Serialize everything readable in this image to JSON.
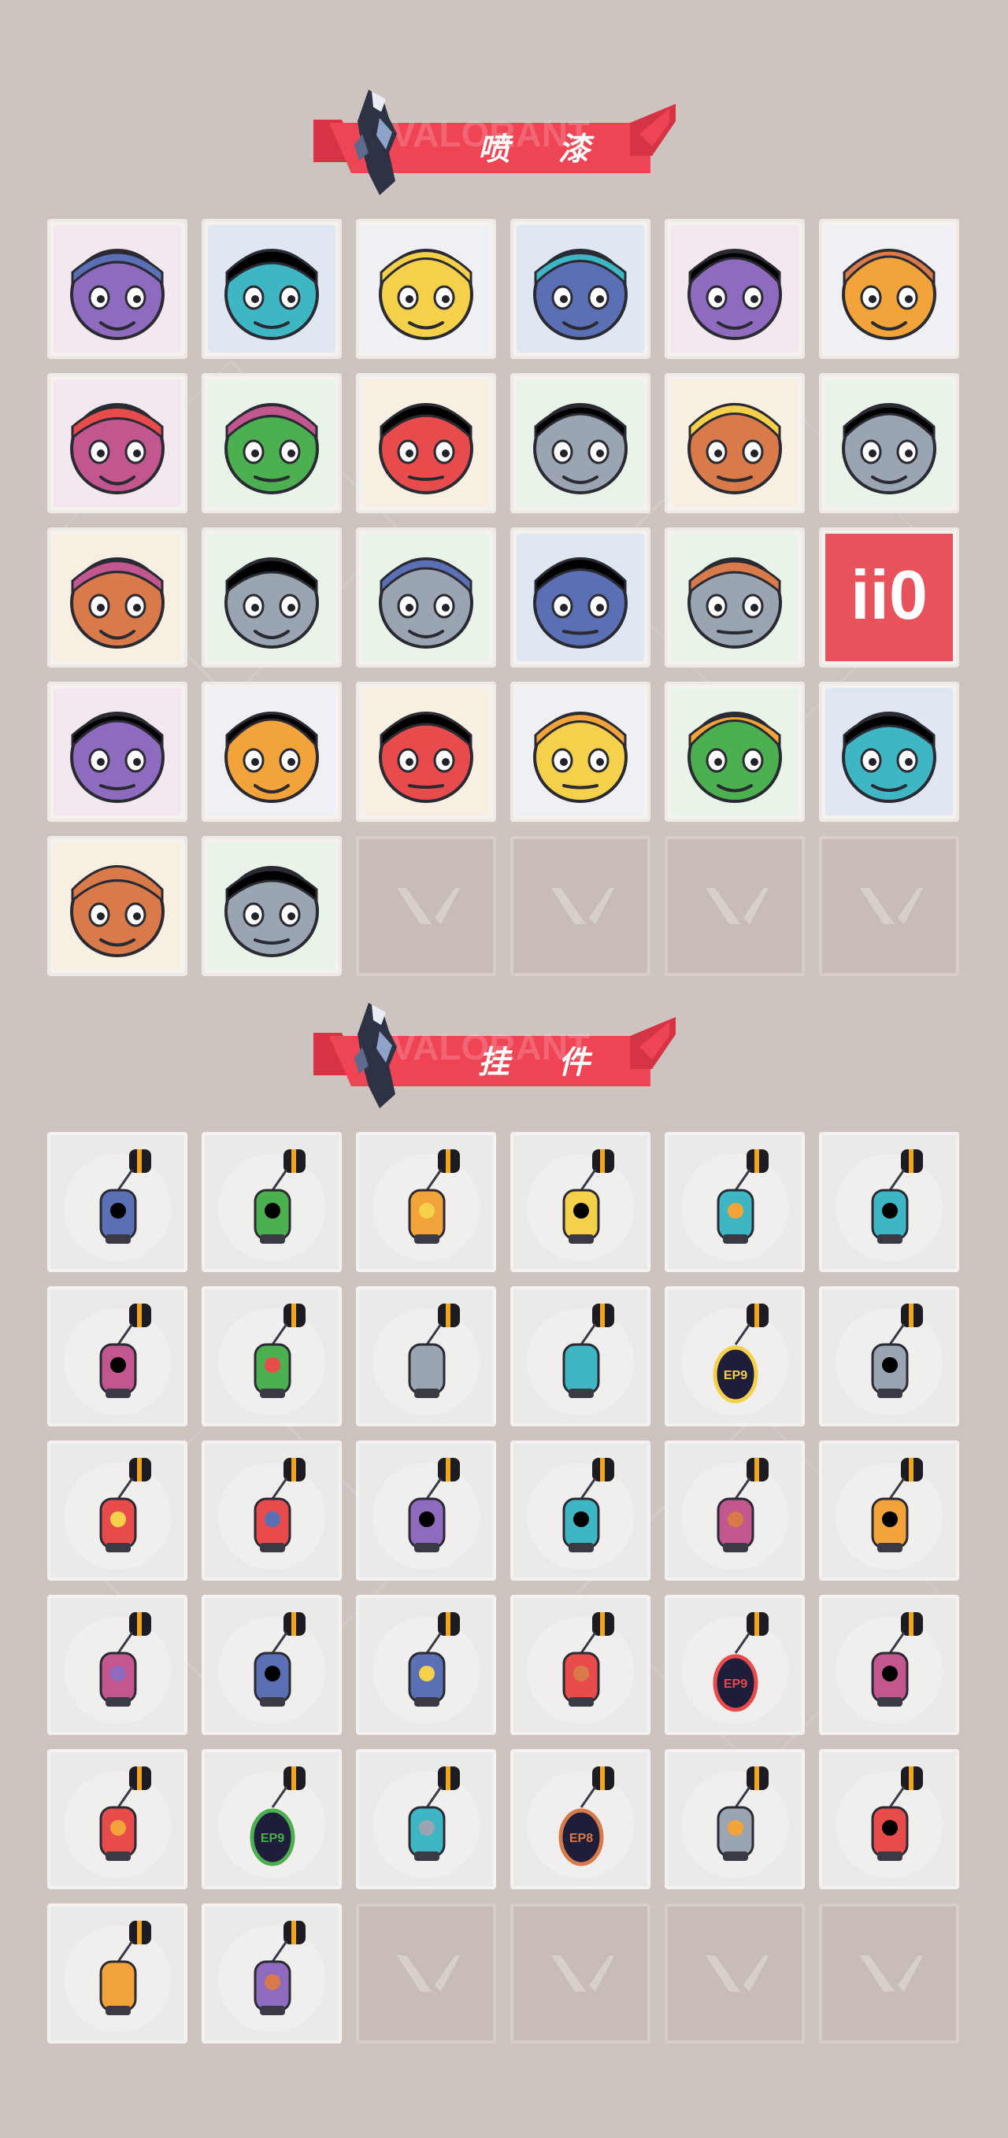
{
  "sections": [
    {
      "id": "sprays",
      "title": "喷 漆",
      "items": [
        {
          "name": "pixel-agent-spray",
          "icon": "pixel-agent-icon"
        },
        {
          "name": "armored-knight-spray",
          "icon": "armored-knight-icon"
        },
        {
          "name": "clown-face-spray",
          "icon": "clown-face-icon"
        },
        {
          "name": "top-hat-spray",
          "icon": "top-hat-icon"
        },
        {
          "name": "raccoon-sunglasses-spray",
          "icon": "raccoon-icon"
        },
        {
          "name": "bearded-man-spray",
          "icon": "bearded-man-icon"
        },
        {
          "name": "anime-boy-spray",
          "icon": "anime-boy-icon"
        },
        {
          "name": "green-crate-spray",
          "icon": "green-crate-icon"
        },
        {
          "name": "green-eyes-spray",
          "icon": "green-eyes-icon"
        },
        {
          "name": "crying-creature-spray",
          "icon": "crying-creature-icon"
        },
        {
          "name": "tiger-spray",
          "icon": "tiger-icon"
        },
        {
          "name": "angry-girl-spray",
          "icon": "angry-girl-icon"
        },
        {
          "name": "penguin-beanie-spray",
          "icon": "penguin-icon"
        },
        {
          "name": "frog-witch-spray",
          "icon": "frog-witch-icon"
        },
        {
          "name": "grey-cat-spray",
          "icon": "grey-cat-icon"
        },
        {
          "name": "hooded-agent-spray",
          "icon": "hooded-agent-icon"
        },
        {
          "name": "bearded-smirk-spray",
          "icon": "bearded-smirk-icon"
        },
        {
          "name": "number-sign-spray",
          "icon": "number-sign-icon",
          "text": "ii0"
        },
        {
          "name": "armored-bird-spray",
          "icon": "armored-bird-icon"
        },
        {
          "name": "red-x-spray",
          "icon": "red-x-icon"
        },
        {
          "name": "wave-bear-spray",
          "icon": "wave-bear-icon"
        },
        {
          "name": "shark-spray",
          "icon": "shark-icon"
        },
        {
          "name": "glasses-man-spray",
          "icon": "glasses-man-icon"
        },
        {
          "name": "valorant-logo-teal-spray",
          "icon": "valorant-logo-icon"
        },
        {
          "name": "purple-graffiti-spray",
          "icon": "graffiti-icon"
        },
        {
          "name": "red-valorant-circle-spray",
          "icon": "red-logo-circle-icon"
        }
      ],
      "empty_slots": 4
    },
    {
      "id": "charms",
      "title": "挂 件",
      "items": [
        {
          "name": "gold-cat-charm",
          "icon": "gold-cat-icon"
        },
        {
          "name": "robot-drone-charm",
          "icon": "robot-drone-icon"
        },
        {
          "name": "basket-charm",
          "icon": "basket-icon"
        },
        {
          "name": "armored-cat-charm",
          "icon": "armored-cat-icon"
        },
        {
          "name": "round-pouch-charm",
          "icon": "pouch-icon"
        },
        {
          "name": "energy-canister-charm",
          "icon": "canister-icon"
        },
        {
          "name": "spiked-club-charm",
          "icon": "spiked-club-icon"
        },
        {
          "name": "orange-fish-charm",
          "icon": "fish-icon"
        },
        {
          "name": "braided-cord-charm",
          "icon": "cord-icon"
        },
        {
          "name": "cupcake-charm",
          "icon": "cupcake-icon"
        },
        {
          "name": "ep9-purple-charm",
          "icon": "ep9-badge-icon",
          "text": "EP9"
        },
        {
          "name": "bear-bell-charm",
          "icon": "bear-bell-icon"
        },
        {
          "name": "radio-device-charm",
          "icon": "radio-icon"
        },
        {
          "name": "agent-figure-charm",
          "icon": "agent-figure-icon"
        },
        {
          "name": "hat-figure-charm",
          "icon": "hat-figure-icon"
        },
        {
          "name": "wooden-box-charm",
          "icon": "box-icon"
        },
        {
          "name": "black-creature-charm",
          "icon": "creature-icon"
        },
        {
          "name": "dark-bird-charm",
          "icon": "bird-icon"
        },
        {
          "name": "lava-lamp-charm",
          "icon": "lava-lamp-icon"
        },
        {
          "name": "green-pager-charm",
          "icon": "pager-icon"
        },
        {
          "name": "astronaut-charm",
          "icon": "astronaut-icon"
        },
        {
          "name": "walkie-talkie-charm",
          "icon": "walkie-talkie-icon"
        },
        {
          "name": "ep9-violet-charm",
          "icon": "ep9-badge-icon",
          "text": "EP9"
        },
        {
          "name": "silver-agent-charm",
          "icon": "silver-agent-icon"
        },
        {
          "name": "soda-can-charm",
          "icon": "soda-can-icon"
        },
        {
          "name": "ep9-gold-charm",
          "icon": "ep9-badge-icon",
          "text": "EP9"
        },
        {
          "name": "white-outline-charm",
          "icon": "outline-badge-icon"
        },
        {
          "name": "ep8-green-charm",
          "icon": "ep8-badge-icon",
          "text": "EP8"
        },
        {
          "name": "ufo-charm",
          "icon": "ufo-icon"
        },
        {
          "name": "koi-fish-charm",
          "icon": "koi-icon"
        },
        {
          "name": "bronze-medallion-charm",
          "icon": "medallion-icon"
        },
        {
          "name": "black-v-charm",
          "icon": "v-badge-icon"
        }
      ],
      "empty_slots": 4
    }
  ],
  "colors": {
    "background": "#cdc4c0",
    "banner_red": "#ef4453",
    "banner_dark": "#d63345",
    "tile_border": "#eeeae6",
    "empty_tile": "#c8bdb6"
  }
}
